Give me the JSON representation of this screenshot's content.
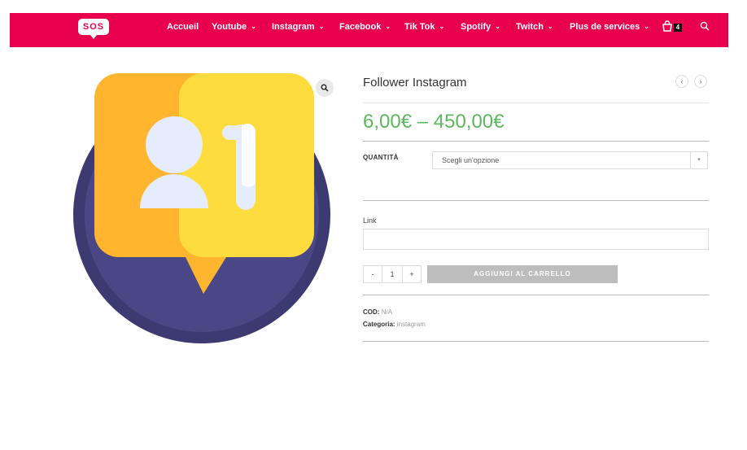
{
  "logo": "SOS",
  "nav": [
    {
      "label": "Accueil",
      "dropdown": false
    },
    {
      "label": "Youtube",
      "dropdown": true
    },
    {
      "label": "Instagram",
      "dropdown": true
    },
    {
      "label": "Facebook",
      "dropdown": true
    },
    {
      "label": "Tik Tok",
      "dropdown": true
    },
    {
      "label": "Spotify",
      "dropdown": true
    },
    {
      "label": "Twitch",
      "dropdown": true
    },
    {
      "label": "Plus de services",
      "dropdown": true
    }
  ],
  "cart_count": "4",
  "product": {
    "title": "Follower Instagram",
    "price": "6,00€ – 450,00€",
    "quantity_label": "QUANTITÀ",
    "quantity_select": "Scegli un'opzione",
    "link_label": "Link",
    "link_value": "",
    "qty_minus": "-",
    "qty_value": "1",
    "qty_plus": "+",
    "add_to_cart": "AGGIUNGI AL CARRELLO",
    "sku_label": "COD:",
    "sku_value": "N/A",
    "category_label": "Categoria:",
    "category_value": "instagram"
  },
  "colors": {
    "brand": "#e8004f",
    "price": "#5cb85c",
    "button": "#bdbdbd"
  },
  "icons": [
    "chevron-down-icon",
    "shopping-bag-icon",
    "search-icon",
    "zoom-icon",
    "chevron-left-icon",
    "chevron-right-icon"
  ]
}
